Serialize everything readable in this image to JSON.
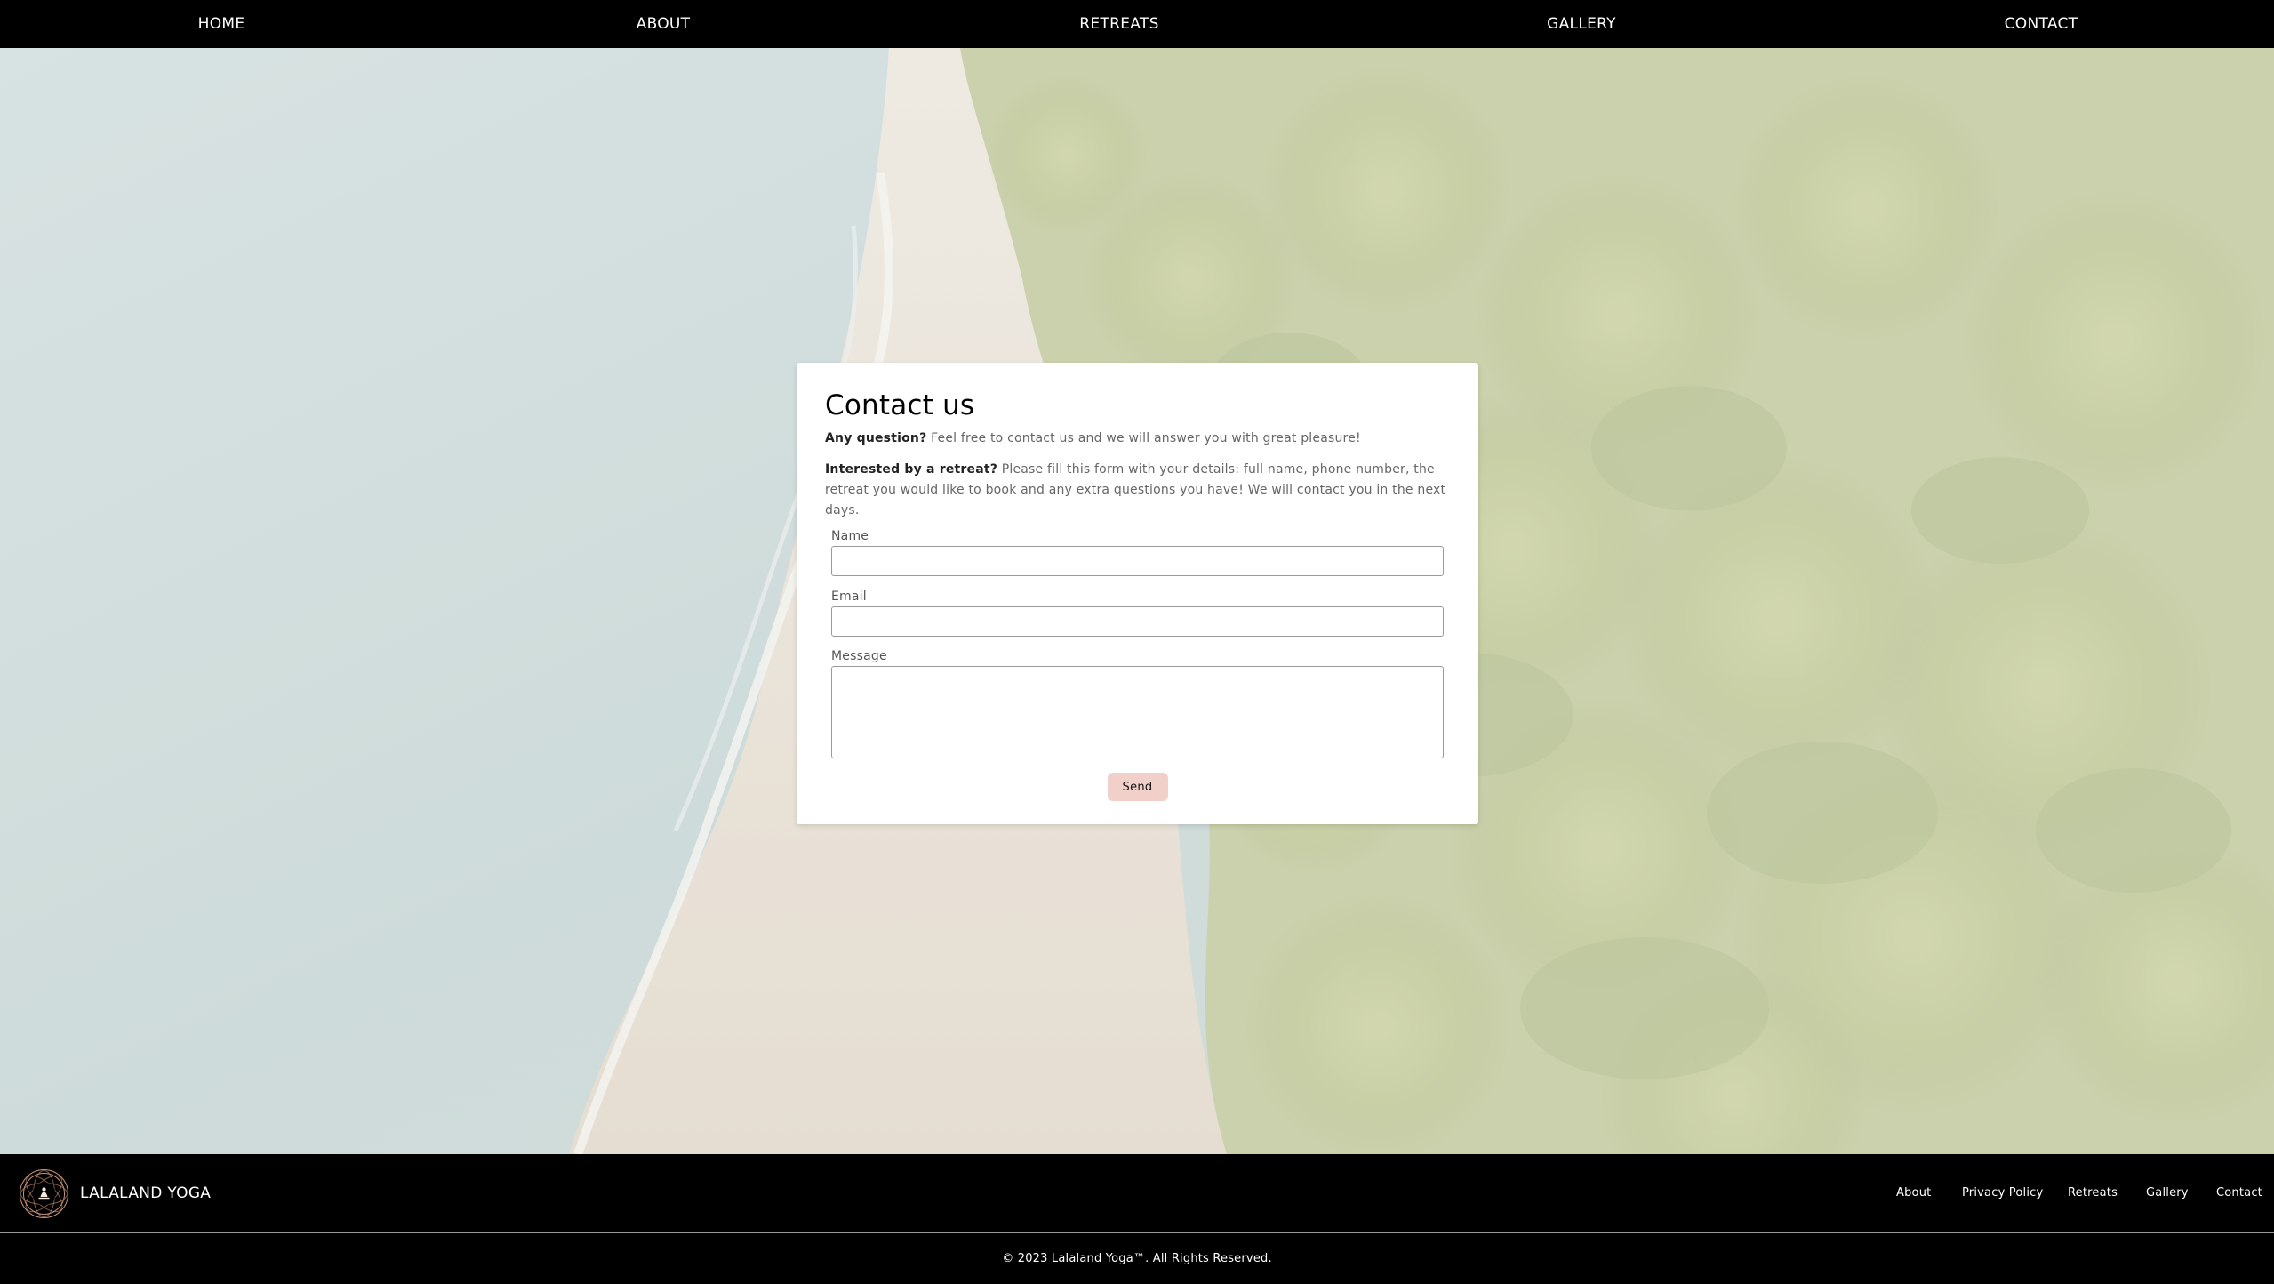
{
  "nav": {
    "home": "HOME",
    "about": "ABOUT",
    "retreats": "RETREATS",
    "gallery": "GALLERY",
    "contact": "CONTACT"
  },
  "contact_form": {
    "title": "Contact us",
    "intro_bold": "Any question?",
    "intro_text": " Feel free to contact us and we will answer you with great pleasure!",
    "retreat_bold": "Interested by a retreat?",
    "retreat_text": " Please fill this form with your details: full name, phone number, the retreat you would like to book and any extra questions you have! We will contact you in the next days.",
    "name_label": "Name",
    "name_value": "",
    "email_label": "Email",
    "email_value": "",
    "message_label": "Message",
    "message_value": "",
    "send_label": "Send"
  },
  "footer": {
    "brand": "LALALAND YOGA",
    "links": {
      "about": "About",
      "privacy": "Privacy Policy",
      "retreats": "Retreats",
      "gallery": "Gallery",
      "contact": "Contact"
    },
    "copyright": "© 2023 Lalaland Yoga™. All Rights Reserved."
  },
  "colors": {
    "nav_bg": "#000000",
    "send_button": "#f1d0c9",
    "logo_ring": "#c9967a"
  },
  "icons": {
    "logo": "meditation-lotus-icon"
  }
}
